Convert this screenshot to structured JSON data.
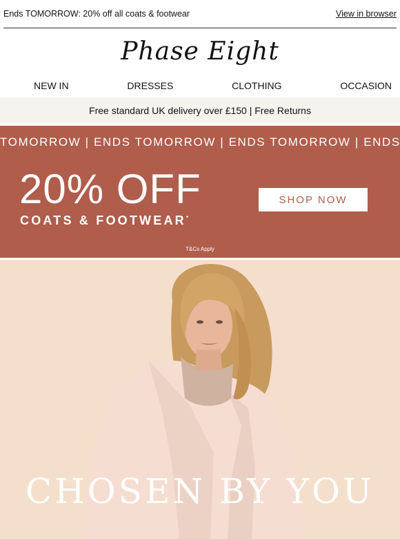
{
  "preheader": {
    "text": "Ends TOMORROW: 20% off all coats & footwear",
    "view_link": "View in browser"
  },
  "brand": {
    "logo_text": "Phase Eight"
  },
  "nav": {
    "items": [
      {
        "label": "NEW IN"
      },
      {
        "label": "DRESSES"
      },
      {
        "label": "CLOTHING"
      },
      {
        "label": "OCCASION"
      }
    ]
  },
  "delivery_banner": {
    "text": "Free standard UK delivery over £150 | Free Returns"
  },
  "promo": {
    "ticker": "TOMORROW | ENDS TOMORROW | ENDS TOMORROW | ENDS TOMORROW",
    "headline": "20% OFF",
    "subheadline": "COATS & FOOTWEAR",
    "asterisk": "*",
    "cta": "SHOP NOW",
    "terms": "T&Cs Apply",
    "colors": {
      "background": "#b05d4c",
      "text": "#ffffff"
    }
  },
  "hero": {
    "title": "CHOSEN BY YOU",
    "image_alt_icon": "model-in-pink-coat-image"
  }
}
